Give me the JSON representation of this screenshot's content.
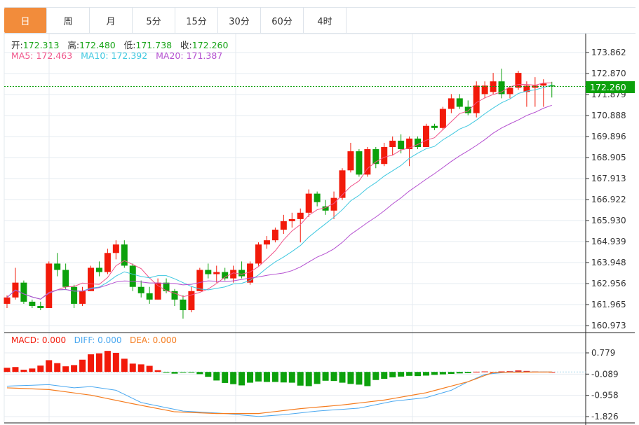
{
  "tabs": [
    "日",
    "周",
    "月",
    "5分",
    "15分",
    "30分",
    "60分",
    "4时"
  ],
  "active_tab": 0,
  "ohlc": {
    "open_label": "开:",
    "open": "172.313",
    "high_label": "高:",
    "high": "172.480",
    "low_label": "低:",
    "low": "171.738",
    "close_label": "收:",
    "close": "172.260"
  },
  "ma": {
    "ma5": "MA5: 172.463",
    "ma10": "MA10: 172.392",
    "ma20": "MA20: 171.387"
  },
  "macd_legend": {
    "macd": "MACD: 0.000",
    "diff": "DIFF: 0.000",
    "dea": "DEA: 0.000"
  },
  "current_price": "172.260",
  "colors": {
    "up": "#f21a0a",
    "down": "#0ca10c",
    "ma5": "#f0548a",
    "ma10": "#3fc8e0",
    "ma20": "#b44fd0",
    "diff": "#4aa8f0",
    "dea": "#f57c1f",
    "accent": "#f28c3b"
  },
  "chart_data": {
    "type": "candlestick",
    "price_axis": {
      "ticks": [
        173.862,
        172.87,
        171.879,
        170.888,
        169.896,
        168.905,
        167.913,
        166.922,
        165.93,
        164.939,
        163.948,
        162.956,
        161.965,
        160.973
      ]
    },
    "candles": [
      [
        162.0,
        162.4,
        161.8,
        162.3
      ],
      [
        162.3,
        163.7,
        162.2,
        163.0
      ],
      [
        163.0,
        163.1,
        162.0,
        162.1
      ],
      [
        162.1,
        162.2,
        161.8,
        161.9
      ],
      [
        161.9,
        162.1,
        161.7,
        161.8
      ],
      [
        161.8,
        164.0,
        161.8,
        163.9
      ],
      [
        163.9,
        164.4,
        163.3,
        163.6
      ],
      [
        163.6,
        163.9,
        162.7,
        162.8
      ],
      [
        162.8,
        162.9,
        161.8,
        162.0
      ],
      [
        162.0,
        162.8,
        161.9,
        162.6
      ],
      [
        162.6,
        163.8,
        162.6,
        163.7
      ],
      [
        163.7,
        164.0,
        163.3,
        163.5
      ],
      [
        163.5,
        164.6,
        163.4,
        164.4
      ],
      [
        164.4,
        165.0,
        164.1,
        164.8
      ],
      [
        164.8,
        165.0,
        163.7,
        163.8
      ],
      [
        163.8,
        163.9,
        162.6,
        162.8
      ],
      [
        162.8,
        163.1,
        162.3,
        162.5
      ],
      [
        162.5,
        162.8,
        162.0,
        162.2
      ],
      [
        162.2,
        163.2,
        162.2,
        163.0
      ],
      [
        163.0,
        163.2,
        162.5,
        162.6
      ],
      [
        162.6,
        162.7,
        161.9,
        162.2
      ],
      [
        162.2,
        162.4,
        161.3,
        161.7
      ],
      [
        161.7,
        162.8,
        161.6,
        162.6
      ],
      [
        162.6,
        163.7,
        162.6,
        163.6
      ],
      [
        163.6,
        163.9,
        163.2,
        163.4
      ],
      [
        163.4,
        163.8,
        163.0,
        163.5
      ],
      [
        163.5,
        163.7,
        163.1,
        163.2
      ],
      [
        163.2,
        163.8,
        163.0,
        163.6
      ],
      [
        163.6,
        164.0,
        163.2,
        163.3
      ],
      [
        163.0,
        164.0,
        162.9,
        163.9
      ],
      [
        163.9,
        164.9,
        163.8,
        164.8
      ],
      [
        164.8,
        165.2,
        164.6,
        165.0
      ],
      [
        165.0,
        165.6,
        164.9,
        165.5
      ],
      [
        165.5,
        166.2,
        165.3,
        165.9
      ],
      [
        165.9,
        166.3,
        165.6,
        166.0
      ],
      [
        166.0,
        166.5,
        164.9,
        166.3
      ],
      [
        166.3,
        167.4,
        166.1,
        167.2
      ],
      [
        167.2,
        167.3,
        166.6,
        166.8
      ],
      [
        166.6,
        166.9,
        166.2,
        166.4
      ],
      [
        166.4,
        167.3,
        166.0,
        167.0
      ],
      [
        167.0,
        168.4,
        166.9,
        168.3
      ],
      [
        168.3,
        169.6,
        168.2,
        169.2
      ],
      [
        169.2,
        169.3,
        168.0,
        168.1
      ],
      [
        168.1,
        169.4,
        168.0,
        169.3
      ],
      [
        169.3,
        169.4,
        168.4,
        168.6
      ],
      [
        168.6,
        169.6,
        168.5,
        169.4
      ],
      [
        169.4,
        169.9,
        169.0,
        169.7
      ],
      [
        169.7,
        170.0,
        169.1,
        169.3
      ],
      [
        169.3,
        169.9,
        168.5,
        169.8
      ],
      [
        169.8,
        169.9,
        169.3,
        169.4
      ],
      [
        169.4,
        170.5,
        169.4,
        170.4
      ],
      [
        170.4,
        170.5,
        170.2,
        170.3
      ],
      [
        170.3,
        171.3,
        170.2,
        171.2
      ],
      [
        171.2,
        171.9,
        171.0,
        171.7
      ],
      [
        171.7,
        171.9,
        171.2,
        171.3
      ],
      [
        171.3,
        171.6,
        170.9,
        171.0
      ],
      [
        171.0,
        172.5,
        170.8,
        172.3
      ],
      [
        171.9,
        172.5,
        171.7,
        172.3
      ],
      [
        172.0,
        172.9,
        171.9,
        172.5
      ],
      [
        172.5,
        173.1,
        171.7,
        171.9
      ],
      [
        171.9,
        172.2,
        171.7,
        172.2
      ],
      [
        172.2,
        173.0,
        172.1,
        172.9
      ],
      [
        172.0,
        172.5,
        171.3,
        172.3
      ],
      [
        172.2,
        172.7,
        171.3,
        172.3
      ],
      [
        172.3,
        172.6,
        171.3,
        172.4
      ],
      [
        172.313,
        172.48,
        171.738,
        172.26
      ]
    ],
    "macd_axis": {
      "ticks": [
        0.779,
        -0.089,
        -0.958,
        -1.826
      ]
    },
    "macd_hist": [
      0.17,
      0.2,
      0.09,
      0.14,
      0.26,
      0.48,
      0.36,
      0.23,
      0.28,
      0.5,
      0.72,
      0.76,
      0.86,
      0.78,
      0.54,
      0.34,
      0.31,
      0.25,
      0.07,
      -0.03,
      -0.07,
      -0.02,
      -0.01,
      -0.09,
      -0.2,
      -0.35,
      -0.45,
      -0.5,
      -0.55,
      -0.44,
      -0.39,
      -0.41,
      -0.41,
      -0.43,
      -0.44,
      -0.56,
      -0.58,
      -0.49,
      -0.36,
      -0.37,
      -0.44,
      -0.49,
      -0.52,
      -0.58,
      -0.33,
      -0.28,
      -0.22,
      -0.19,
      -0.16,
      -0.17,
      -0.15,
      -0.12,
      -0.1,
      -0.08,
      -0.06,
      -0.05,
      0.01,
      0.02,
      0.0,
      0.02,
      0.03,
      0.06,
      0.04,
      0.02,
      0.01,
      0.0
    ],
    "diff_keypoints": [
      [
        0,
        -0.58
      ],
      [
        5,
        -0.52
      ],
      [
        8,
        -0.65
      ],
      [
        10,
        -0.6
      ],
      [
        13,
        -0.75
      ],
      [
        16,
        -1.25
      ],
      [
        21,
        -1.6
      ],
      [
        26,
        -1.7
      ],
      [
        30,
        -1.82
      ],
      [
        33,
        -1.75
      ],
      [
        37,
        -1.6
      ],
      [
        42,
        -1.48
      ],
      [
        46,
        -1.2
      ],
      [
        50,
        -1.05
      ],
      [
        53,
        -0.75
      ],
      [
        55,
        -0.4
      ],
      [
        57,
        -0.1
      ],
      [
        60,
        0.0
      ],
      [
        65,
        0.0
      ]
    ],
    "dea_keypoints": [
      [
        0,
        -0.65
      ],
      [
        5,
        -0.72
      ],
      [
        10,
        -0.95
      ],
      [
        15,
        -1.3
      ],
      [
        20,
        -1.63
      ],
      [
        25,
        -1.7
      ],
      [
        30,
        -1.7
      ],
      [
        35,
        -1.5
      ],
      [
        40,
        -1.35
      ],
      [
        45,
        -1.15
      ],
      [
        50,
        -0.85
      ],
      [
        55,
        -0.4
      ],
      [
        58,
        -0.02
      ],
      [
        65,
        0.0
      ]
    ]
  }
}
